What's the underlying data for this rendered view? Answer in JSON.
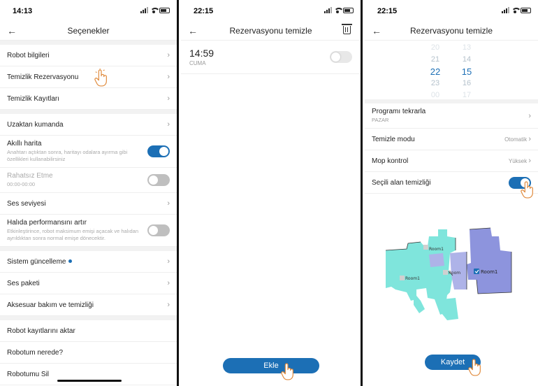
{
  "colors": {
    "accent": "#1c6fb5",
    "map_cyan": "#7fe5dc",
    "map_blue": "#8d94dd",
    "toggle_off": "#bfbfbf"
  },
  "screen1": {
    "status_time": "14:13",
    "title": "Seçenekler",
    "rows": [
      {
        "label": "Robot bilgileri"
      },
      {
        "label": "Temizlik Rezervasyonu"
      },
      {
        "label": "Temizlik Kayıtları"
      },
      {
        "label": "Uzaktan kumanda"
      },
      {
        "label": "Akıllı harita",
        "sub": "Anahtarı açtıktan sonra, haritayı odalara ayırma gibi özellikleri kullanabilirsiniz",
        "toggle": "on"
      },
      {
        "label": "Rahatsız Etme",
        "sub": "00:00-00:00",
        "toggle": "off"
      },
      {
        "label": "Ses seviyesi"
      },
      {
        "label": "Halıda performansını artır",
        "sub": "Etkinleştirince, robot maksimum emişi açacak ve halıdan ayrıldıktan sonra normal emişe dönecektir.",
        "toggle": "off"
      },
      {
        "label": "Sistem güncelleme"
      },
      {
        "label": "Ses paketi"
      },
      {
        "label": "Aksesuar bakım ve temizliği"
      },
      {
        "label": "Robot kayıtlarını aktar"
      },
      {
        "label": "Robotum nerede?"
      },
      {
        "label": "Robotumu Sil"
      }
    ]
  },
  "screen2": {
    "status_time": "22:15",
    "title": "Rezervasyonu temizle",
    "schedule_time": "14:59",
    "schedule_day": "CUMA",
    "schedule_enabled": false,
    "add_button": "Ekle"
  },
  "screen3": {
    "status_time": "22:15",
    "title": "Rezervasyonu temizle",
    "picker_hours": [
      "20",
      "21",
      "22",
      "23",
      "00"
    ],
    "picker_minutes": [
      "13",
      "14",
      "15",
      "16",
      "17"
    ],
    "selected_hour": "22",
    "selected_minute": "15",
    "repeat_label": "Programı tekrarla",
    "repeat_value": "PAZAR",
    "mode_label": "Temizle modu",
    "mode_value": "Otomatik",
    "mop_label": "Mop kontrol",
    "mop_value": "Yüksek",
    "selected_area_label": "Seçili alan temizliği",
    "selected_area_enabled": true,
    "rooms": [
      "Room1",
      "Room1",
      "Room1"
    ],
    "save_button": "Kaydet"
  }
}
